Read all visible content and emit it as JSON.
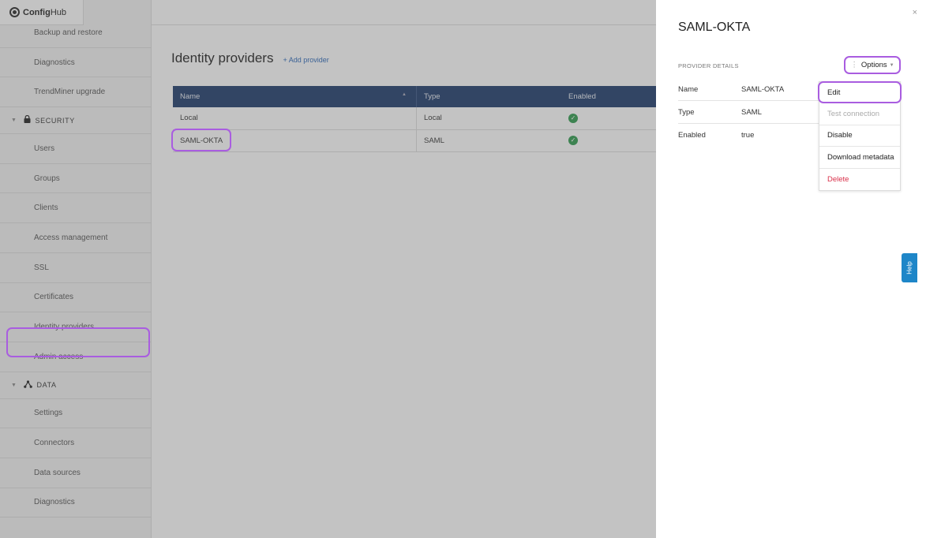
{
  "app": {
    "logo_bold": "Config",
    "logo_light": "Hub"
  },
  "sidebar": {
    "items_top": [
      {
        "label": "Backup and restore"
      },
      {
        "label": "Diagnostics"
      },
      {
        "label": "TrendMiner upgrade"
      }
    ],
    "security_section": "SECURITY",
    "security_items": [
      {
        "label": "Users"
      },
      {
        "label": "Groups"
      },
      {
        "label": "Clients"
      },
      {
        "label": "Access management"
      },
      {
        "label": "SSL"
      },
      {
        "label": "Certificates"
      },
      {
        "label": "Identity providers"
      },
      {
        "label": "Admin access"
      }
    ],
    "data_section": "DATA",
    "data_items": [
      {
        "label": "Settings"
      },
      {
        "label": "Connectors"
      },
      {
        "label": "Data sources"
      },
      {
        "label": "Diagnostics"
      }
    ]
  },
  "main": {
    "title": "Identity providers",
    "add_link": "+ Add provider",
    "columns": [
      "Name",
      "Type",
      "Enabled"
    ],
    "rows": [
      {
        "name": "Local",
        "type": "Local",
        "enabled": true
      },
      {
        "name": "SAML-OKTA",
        "type": "SAML",
        "enabled": true
      }
    ]
  },
  "drawer": {
    "title": "SAML-OKTA",
    "close": "×",
    "section_label": "PROVIDER DETAILS",
    "options_label": "Options",
    "details": [
      {
        "key": "Name",
        "value": "SAML-OKTA"
      },
      {
        "key": "Type",
        "value": "SAML"
      },
      {
        "key": "Enabled",
        "value": "true"
      }
    ],
    "menu": [
      {
        "label": "Edit",
        "state": "highlighted"
      },
      {
        "label": "Test connection",
        "state": "disabled"
      },
      {
        "label": "Disable",
        "state": "normal"
      },
      {
        "label": "Download metadata",
        "state": "normal"
      },
      {
        "label": "Delete",
        "state": "danger"
      }
    ],
    "help_label": "Help"
  },
  "colors": {
    "highlight": "#a95de0",
    "table_header": "#1d3a6b",
    "link": "#2a66b8",
    "enabled_check": "#2e9b4e",
    "danger": "#d9304a",
    "help_tab": "#1e86c8"
  },
  "icons": {
    "logo": "configuration-gear-icon",
    "security": "lock-icon",
    "data": "network-nodes-icon",
    "enabled": "check-circle-icon",
    "options": "vertical-dots-icon"
  }
}
